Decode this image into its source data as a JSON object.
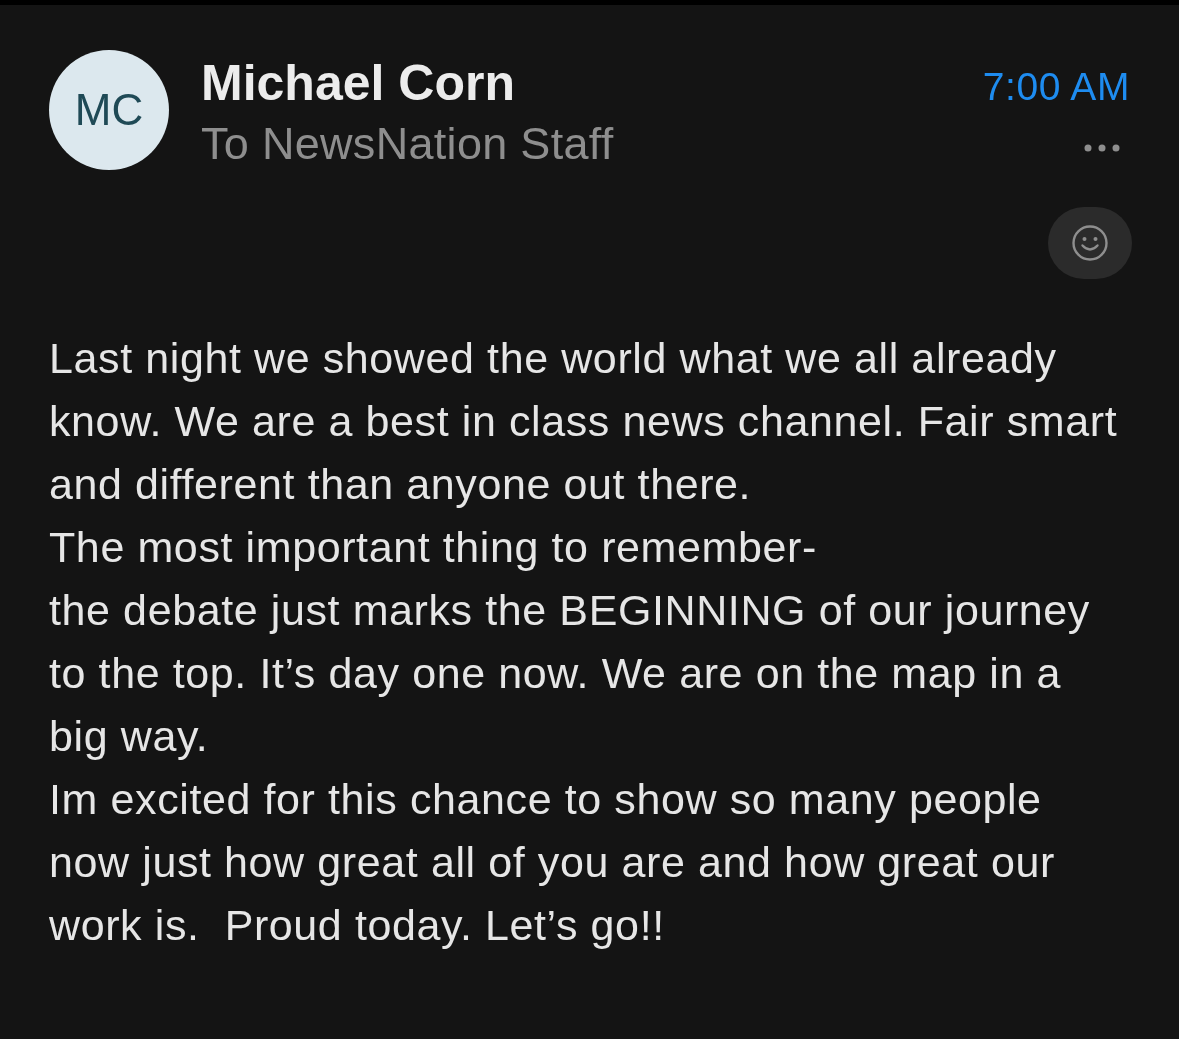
{
  "message": {
    "sender": {
      "initials": "MC",
      "name": "Michael Corn",
      "recipient": "To NewsNation Staff"
    },
    "time": "7:00 AM",
    "body": [
      "Last night we showed the world what we all already know. We are a best in class news channel. Fair smart and different than anyone out there.",
      "The most important thing to remember-",
      "the debate just marks the BEGINNING of our journey to the top. It’s day one now. We are on the map in a big way.",
      "Im excited for this chance to show so many people now just how great all of you are and how great our work is.  Proud today. Let’s go!!"
    ]
  }
}
